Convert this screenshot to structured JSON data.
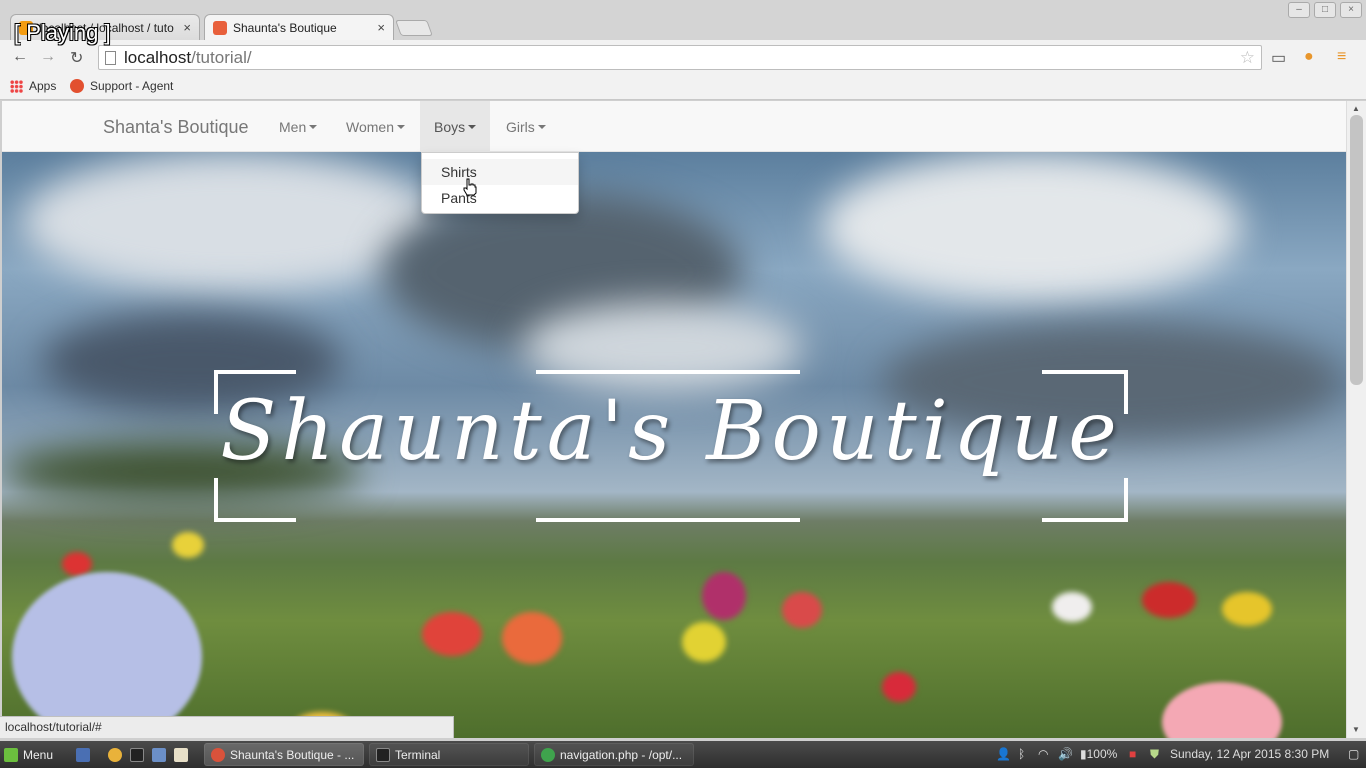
{
  "overlay": {
    "text": "[ Playing ]"
  },
  "tabs": [
    {
      "label": "localhost / localhost / tuto",
      "active": false,
      "fav_color": "#f39c12"
    },
    {
      "label": "Shaunta's Boutique",
      "active": true,
      "fav_color": "#e8603c"
    }
  ],
  "address": {
    "host": "localhost",
    "path": "/tutorial/"
  },
  "bookmarks": [
    {
      "label": "Apps"
    },
    {
      "label": "Support - Agent"
    }
  ],
  "site": {
    "brand": "Shanta's Boutique",
    "nav": [
      {
        "label": "Men"
      },
      {
        "label": "Women"
      },
      {
        "label": "Boys"
      },
      {
        "label": "Girls"
      }
    ],
    "dropdown": [
      "Shirts",
      "Pants"
    ],
    "hero_title": "Shaunta's Boutique"
  },
  "status": {
    "url": "localhost/tutorial/#"
  },
  "taskbar": {
    "menu": "Menu",
    "tasks": [
      {
        "label": "Shaunta's Boutique - ...",
        "active": true,
        "color": "#d9523b"
      },
      {
        "label": "Terminal",
        "active": false,
        "color": "#222222"
      },
      {
        "label": "navigation.php - /opt/...",
        "active": false,
        "color": "#3fa34d"
      }
    ],
    "battery": "100%",
    "datetime": "Sunday, 12 Apr 2015  8:30 PM"
  }
}
